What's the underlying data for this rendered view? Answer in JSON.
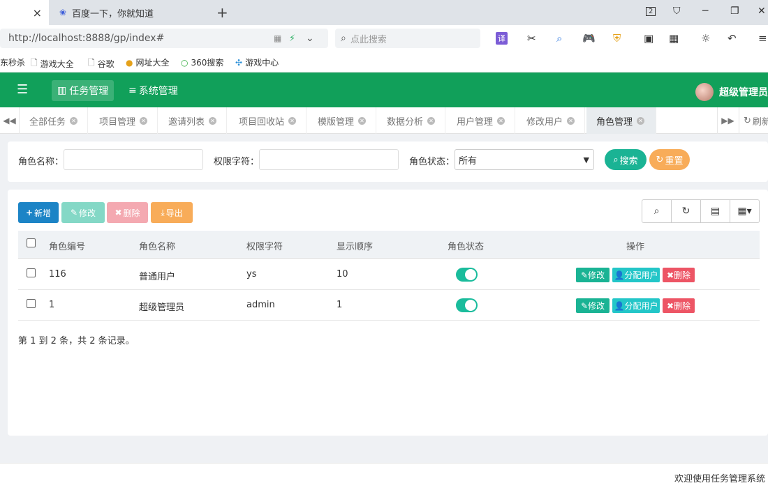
{
  "browser": {
    "tabs": [
      {
        "title": "",
        "close": "×"
      },
      {
        "title": "百度一下，你就知道"
      }
    ],
    "new_tab": "+",
    "window_controls": [
      "2",
      "─",
      "❐",
      "✕"
    ],
    "url": "http://localhost:8888/gp/index#",
    "search_placeholder": "点此搜索",
    "translate_label": "译",
    "bookmarks": [
      "东秒杀",
      "游戏大全",
      "谷歌",
      "网址大全",
      "360搜索",
      "游戏中心"
    ]
  },
  "topnav": {
    "menu_task": "任务管理",
    "menu_system": "系统管理",
    "user_name": "超级管理员"
  },
  "page_tabs": [
    {
      "label": "全部任务"
    },
    {
      "label": "项目管理"
    },
    {
      "label": "邀请列表"
    },
    {
      "label": "项目回收站"
    },
    {
      "label": "模版管理"
    },
    {
      "label": "数据分析"
    },
    {
      "label": "用户管理"
    },
    {
      "label": "修改用户"
    },
    {
      "label": "角色管理",
      "active": true
    }
  ],
  "refresh_label": "刷新",
  "search_form": {
    "role_name_label": "角色名称：",
    "role_key_label": "权限字符：",
    "role_status_label": "角色状态：",
    "role_status_value": "所有",
    "search_button": "搜索",
    "reset_button": "重置"
  },
  "toolbar": {
    "add": "新增",
    "edit": "修改",
    "delete": "删除",
    "export": "导出"
  },
  "table": {
    "headers": [
      "角色编号",
      "角色名称",
      "权限字符",
      "显示顺序",
      "角色状态",
      "操作"
    ],
    "rows": [
      {
        "id": "116",
        "name": "普通用户",
        "key": "ys",
        "order": "10",
        "enabled": true
      },
      {
        "id": "1",
        "name": "超级管理员",
        "key": "admin",
        "order": "1",
        "enabled": true
      }
    ],
    "row_actions": {
      "edit": "修改",
      "assign": "分配用户",
      "delete": "删除"
    }
  },
  "pagination_text": "第 1 到 2 条，共 2 条记录。",
  "footer_text": "欢迎使用任务管理系统",
  "colors": {
    "header_green": "#11a05a",
    "primary_blue": "#1c84c6",
    "teal": "#1ab394",
    "danger": "#ed5565",
    "warning": "#f8ac59",
    "info": "#23c6c8"
  }
}
